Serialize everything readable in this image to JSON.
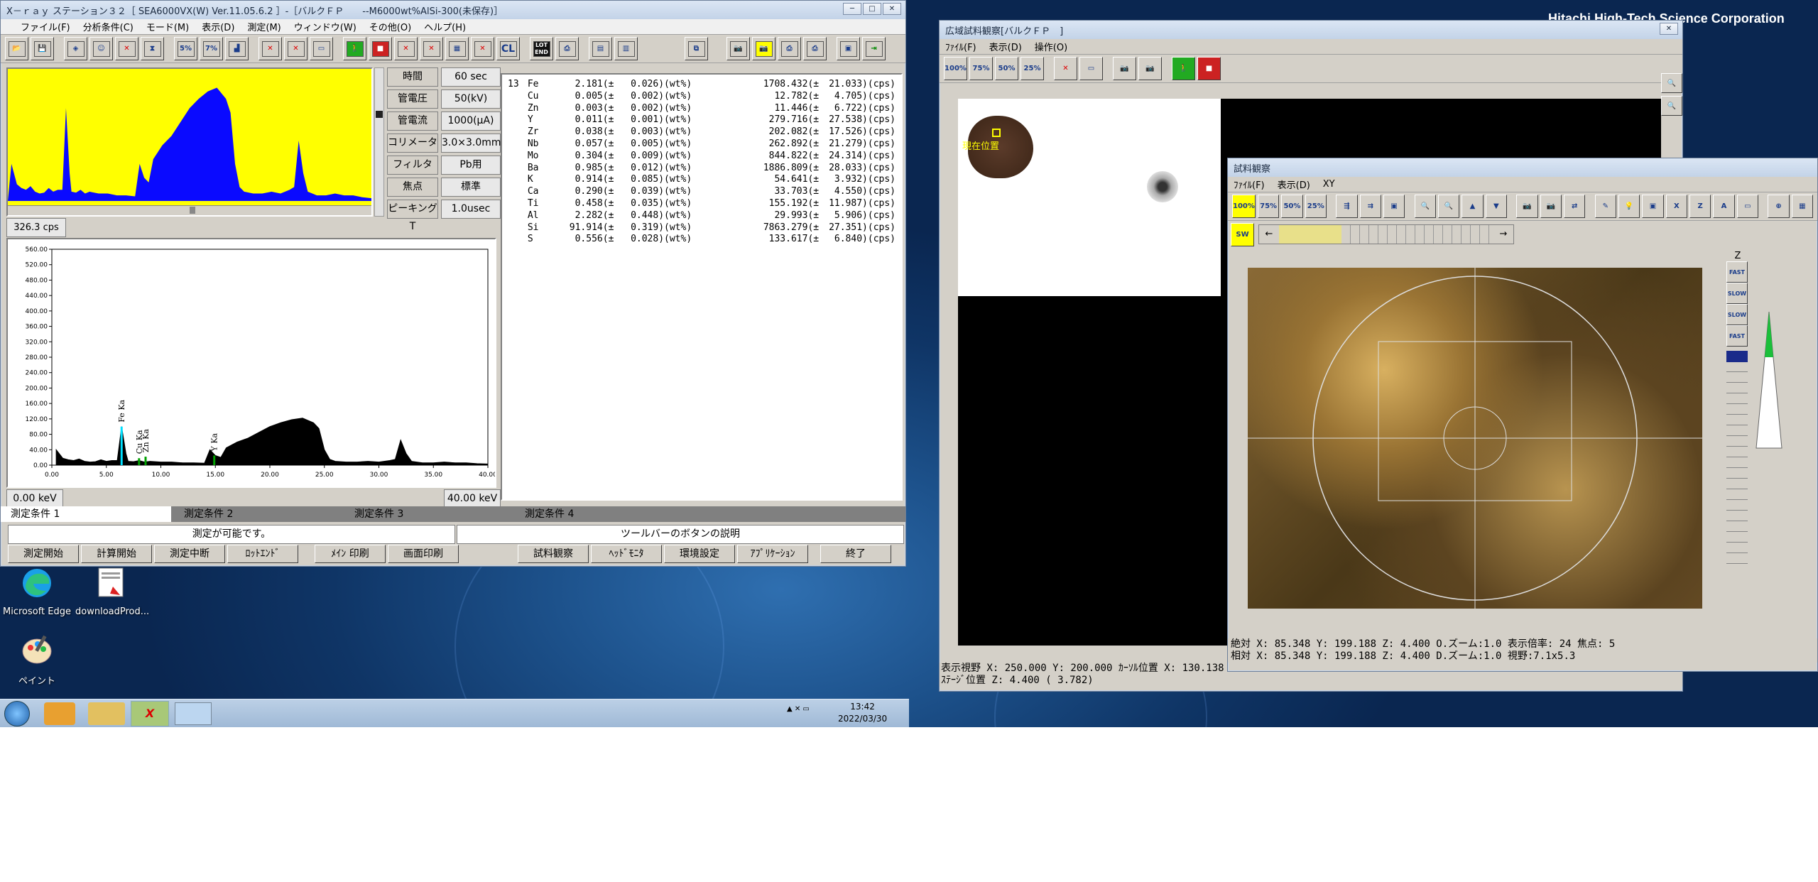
{
  "desktop": {
    "brand": "Hitachi High-Tech Science Corporation",
    "icons": [
      {
        "label": "Microsoft Edge",
        "icon": "edge-icon"
      },
      {
        "label": "downloadProd...",
        "icon": "pdf-icon"
      },
      {
        "label": "ペイント",
        "icon": "paint-icon"
      }
    ]
  },
  "taskbar": {
    "time": "13:42",
    "date": "2022/03/30",
    "apps": [
      "start-orb",
      "media-player",
      "file-explorer",
      "xray-station",
      "window-viewer"
    ]
  },
  "xray": {
    "title": "X－ｒａｙ ステーション３２［ SEA6000VX(W) Ver.11.05.6.2 ］-［バルクＦＰ　　--M6000wt%AlSi-300(未保存)］",
    "menu": [
      "ファイル(F)",
      "分析条件(C)",
      "モード(M)",
      "表示(D)",
      "測定(M)",
      "ウィンドウ(W)",
      "その他(O)",
      "ヘルプ(H)"
    ],
    "toolbar_labels": {
      "pct5": "5%",
      "pct7": "7%",
      "cl": "CL",
      "lot": "LOT END"
    },
    "conditions": [
      {
        "label": "時間",
        "value": "60 sec"
      },
      {
        "label": "管電圧",
        "value": "50(kV)"
      },
      {
        "label": "管電流",
        "value": "1000(μA)"
      },
      {
        "label": "コリメータ",
        "value": "3.0×3.0mm"
      },
      {
        "label": "フィルタ",
        "value": "Pb用"
      },
      {
        "label": "焦点",
        "value": "標準"
      },
      {
        "label": "ピーキングT",
        "value": "1.0usec"
      }
    ],
    "cps": "326.3 cps",
    "kev_min": "0.00 keV",
    "kev_max": "40.00 keV",
    "results": [
      {
        "n": "13",
        "el": "Fe",
        "wt": "2.181(±",
        "err": "0.026)(wt%)",
        "cps": "1708.432(±",
        "cerr": "21.033)(cps)"
      },
      {
        "n": "",
        "el": "Cu",
        "wt": "0.005(±",
        "err": "0.002)(wt%)",
        "cps": "12.782(±",
        "cerr": "4.705)(cps)"
      },
      {
        "n": "",
        "el": "Zn",
        "wt": "0.003(±",
        "err": "0.002)(wt%)",
        "cps": "11.446(±",
        "cerr": "6.722)(cps)"
      },
      {
        "n": "",
        "el": "Y",
        "wt": "0.011(±",
        "err": "0.001)(wt%)",
        "cps": "279.716(±",
        "cerr": "27.538)(cps)"
      },
      {
        "n": "",
        "el": "Zr",
        "wt": "0.038(±",
        "err": "0.003)(wt%)",
        "cps": "202.082(±",
        "cerr": "17.526)(cps)"
      },
      {
        "n": "",
        "el": "Nb",
        "wt": "0.057(±",
        "err": "0.005)(wt%)",
        "cps": "262.892(±",
        "cerr": "21.279)(cps)"
      },
      {
        "n": "",
        "el": "Mo",
        "wt": "0.304(±",
        "err": "0.009)(wt%)",
        "cps": "844.822(±",
        "cerr": "24.314)(cps)"
      },
      {
        "n": "",
        "el": "Ba",
        "wt": "0.985(±",
        "err": "0.012)(wt%)",
        "cps": "1886.809(±",
        "cerr": "28.033)(cps)"
      },
      {
        "n": "",
        "el": "K",
        "wt": "0.914(±",
        "err": "0.085)(wt%)",
        "cps": "54.641(±",
        "cerr": "3.932)(cps)"
      },
      {
        "n": "",
        "el": "Ca",
        "wt": "0.290(±",
        "err": "0.039)(wt%)",
        "cps": "33.703(±",
        "cerr": "4.550)(cps)"
      },
      {
        "n": "",
        "el": "Ti",
        "wt": "0.458(±",
        "err": "0.035)(wt%)",
        "cps": "155.192(±",
        "cerr": "11.987)(cps)"
      },
      {
        "n": "",
        "el": "Al",
        "wt": "2.282(±",
        "err": "0.448)(wt%)",
        "cps": "29.993(±",
        "cerr": "5.906)(cps)"
      },
      {
        "n": "",
        "el": "Si",
        "wt": "91.914(±",
        "err": "0.319)(wt%)",
        "cps": "7863.279(±",
        "cerr": "27.351)(cps)"
      },
      {
        "n": "",
        "el": "S",
        "wt": "0.556(±",
        "err": "0.028)(wt%)",
        "cps": "133.617(±",
        "cerr": "6.840)(cps)"
      }
    ],
    "tabs": [
      "測定条件 1",
      "測定条件 2",
      "測定条件 3",
      "測定条件 4"
    ],
    "status": "測定が可能です。",
    "hint": "ツールバーのボタンの説明",
    "buttons": [
      "測定開始",
      "計算開始",
      "測定中断",
      "ﾛｯﾄｴﾝﾄﾞ",
      "ﾒｲﾝ 印刷",
      "画面印刷",
      "試料観察",
      "ﾍｯﾄﾞﾓﾆﾀ",
      "環境設定",
      "ｱﾌﾟﾘｹｰｼｮﾝ",
      "終了"
    ]
  },
  "chart_data": {
    "type": "line",
    "xlabel": "",
    "ylabel": "",
    "xlim": [
      0,
      40
    ],
    "ylim": [
      0,
      560
    ],
    "xticks": [
      "0.00",
      "5.00",
      "10.00",
      "15.00",
      "20.00",
      "25.00",
      "30.00",
      "35.00",
      "40.00"
    ],
    "yticks": [
      "0.00",
      "40.00",
      "80.00",
      "120.00",
      "160.00",
      "200.00",
      "240.00",
      "280.00",
      "320.00",
      "360.00",
      "400.00",
      "440.00",
      "480.00",
      "520.00",
      "560.00"
    ],
    "peaks": [
      {
        "label": "Fe Ka",
        "x": 6.4,
        "y": 100,
        "color": "#00e0ff"
      },
      {
        "label": "Cu Ka",
        "x": 8.0,
        "y": 18,
        "color": "#00a000"
      },
      {
        "label": "Zn Ka",
        "x": 8.6,
        "y": 22,
        "color": "#00a000"
      },
      {
        "label": "Y Ka",
        "x": 14.9,
        "y": 25,
        "color": "#00a000"
      }
    ],
    "series": [
      {
        "x": [
          0.4,
          1,
          1.5,
          2,
          2.5,
          3,
          3.5,
          4,
          4.5,
          5,
          5.5,
          6,
          6.4,
          6.8,
          7,
          7.5,
          8,
          8.5,
          9,
          9.5,
          10,
          11,
          12,
          13,
          14,
          14.5,
          15,
          15.5,
          16,
          17,
          18,
          19,
          20,
          21,
          22,
          23,
          24,
          24.5,
          25,
          25.5,
          26,
          27,
          28,
          29,
          30,
          31,
          31.5,
          32,
          32.5,
          33,
          34,
          35,
          36,
          37,
          38,
          39,
          40
        ],
        "y": [
          40,
          18,
          14,
          12,
          16,
          10,
          8,
          9,
          14,
          10,
          12,
          12,
          100,
          30,
          10,
          9,
          12,
          8,
          10,
          9,
          8,
          8,
          6,
          6,
          5,
          40,
          25,
          20,
          45,
          60,
          70,
          85,
          100,
          110,
          118,
          122,
          110,
          95,
          40,
          15,
          10,
          8,
          8,
          10,
          8,
          12,
          15,
          65,
          30,
          10,
          6,
          6,
          8,
          6,
          6,
          4,
          3
        ]
      }
    ]
  },
  "wide": {
    "title": "広域試料観察[バルクＦＰ　]",
    "menu": [
      "ﾌｧｲﾙ(F)",
      "表示(D)",
      "操作(O)"
    ],
    "zoom": [
      "100%",
      "75%",
      "50%",
      "25%"
    ],
    "pos_label": "現在位置",
    "status1": "表示視野 X: 250.000 Y: 200.000 ｶｰｿﾙ位置 X: 130.138 Y: 24.256",
    "status2": "ｽﾃｰｼﾞ位置 Z:  4.400 (  3.782)"
  },
  "sample": {
    "title": "試料観察",
    "menu": [
      "ﾌｧｲﾙ(F)",
      "表示(D)",
      "XY"
    ],
    "zoom": [
      "100%",
      "75%",
      "50%",
      "25%"
    ],
    "side": [
      "FAST",
      "SLOW",
      "SLOW",
      "FAST"
    ],
    "z_label": "Z",
    "status1": "絶対 X:  85.348 Y: 199.188 Z:  4.400 O.ズーム:1.0  表示倍率: 24  焦点: 5",
    "status2": "相対 X:  85.348 Y: 199.188 Z:  4.400 D.ズーム:1.0  視野:7.1x5.3"
  }
}
